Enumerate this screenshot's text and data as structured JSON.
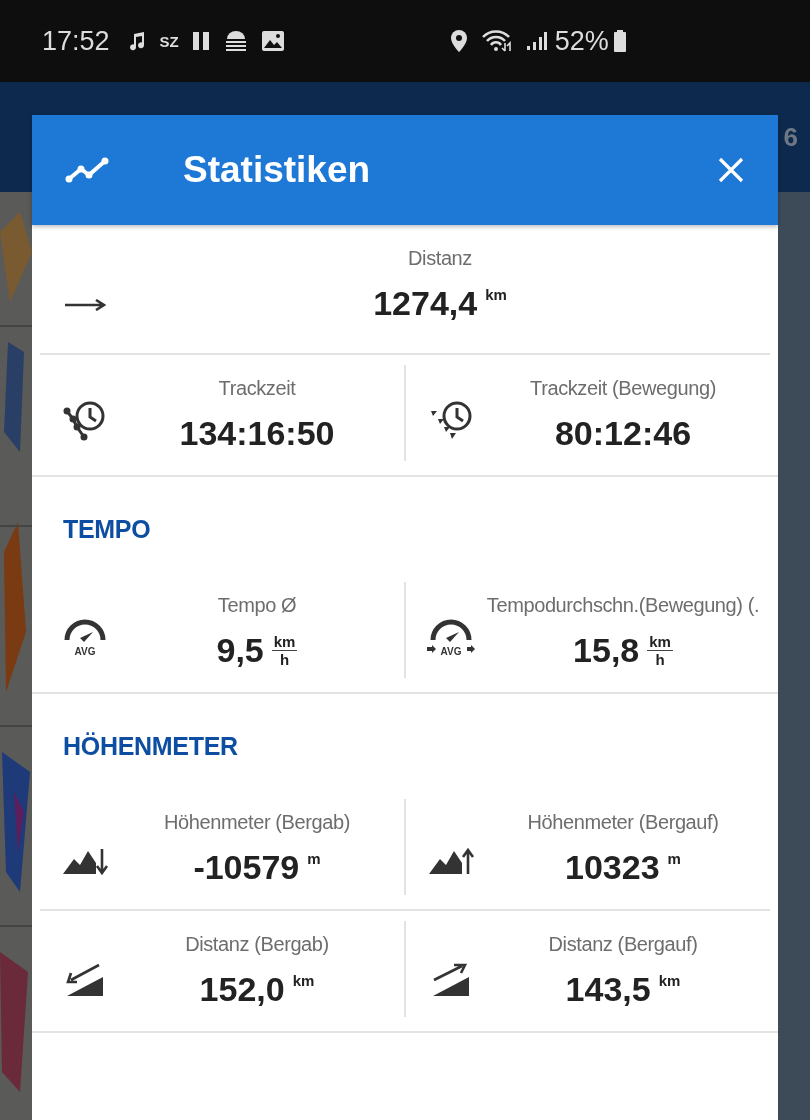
{
  "status_bar": {
    "time": "17:52",
    "notification_text": "SZ",
    "battery": "52%"
  },
  "app_bar": {
    "text": "6"
  },
  "dialog": {
    "title": "Statistiken",
    "sections": [
      {
        "rows": [
          {
            "cells": [
              {
                "kind": "distance",
                "label": "Distanz",
                "value": "1274,4",
                "unit": "km"
              }
            ]
          },
          {
            "cells": [
              {
                "kind": "time",
                "label": "Trackzeit",
                "value": "134:16:50"
              },
              {
                "kind": "moving-time",
                "label": "Trackzeit (Bewegung)",
                "value": "80:12:46"
              }
            ]
          }
        ]
      },
      {
        "heading": "TEMPO",
        "rows": [
          {
            "cells": [
              {
                "kind": "speed-avg",
                "label": "Tempo Ø",
                "value": "9,5",
                "unit_fraction": [
                  "km",
                  "h"
                ],
                "badge": "AVG"
              },
              {
                "kind": "speed-moving",
                "label": "Tempodurchschn.(Bewegung) (.",
                "value": "15,8",
                "unit_fraction": [
                  "km",
                  "h"
                ],
                "badge": "AVG"
              }
            ]
          }
        ]
      },
      {
        "heading": "HÖHENMETER",
        "rows": [
          {
            "cells": [
              {
                "kind": "descent",
                "label": "Höhenmeter (Bergab)",
                "value": "-10579",
                "unit": "m"
              },
              {
                "kind": "ascent",
                "label": "Höhenmeter (Bergauf)",
                "value": "10323",
                "unit": "m"
              }
            ]
          },
          {
            "cells": [
              {
                "kind": "distance-down",
                "label": "Distanz (Bergab)",
                "value": "152,0",
                "unit": "km"
              },
              {
                "kind": "distance-up",
                "label": "Distanz (Bergauf)",
                "value": "143,5",
                "unit": "km"
              }
            ]
          }
        ]
      }
    ]
  }
}
